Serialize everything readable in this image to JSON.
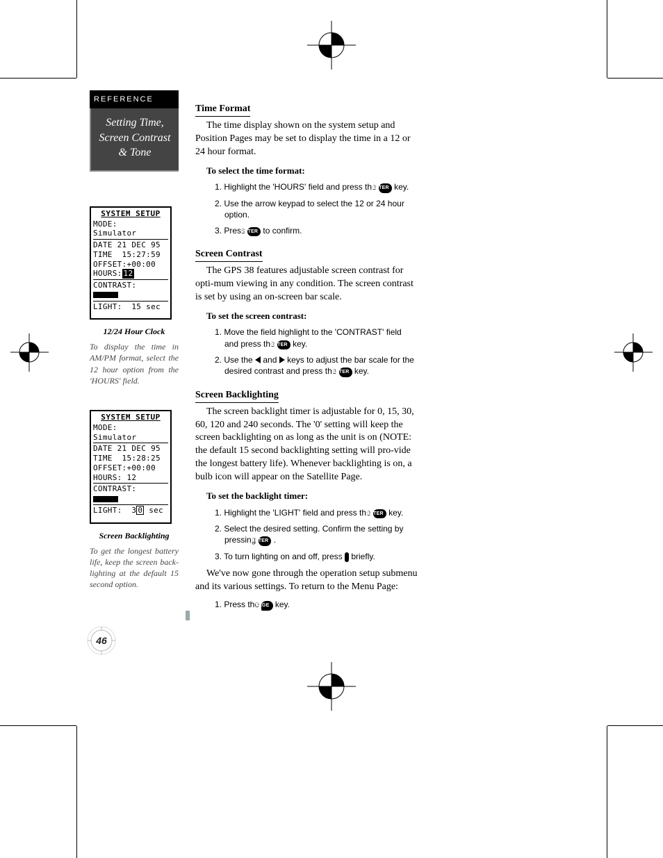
{
  "sidebar": {
    "tab": "REFERENCE",
    "title_l1": "Setting Time,",
    "title_l2": "Screen Contrast",
    "title_l3": "& Tone"
  },
  "lcd1": {
    "header": "SYSTEM SETUP",
    "mode_label": "MODE:",
    "mode_value": "Simulator",
    "date": "DATE 21 DEC 95",
    "time": "TIME  15:27:59",
    "offset": "OFFSET:+00:00",
    "hours_label": "HOURS:",
    "hours_value": "12",
    "contrast_label": "CONTRAST:",
    "light": "LIGHT:  15 sec",
    "caption": "12/24 Hour Clock",
    "note": "To display the time in AM/PM format, select the 12 hour option from the 'HOURS' field."
  },
  "lcd2": {
    "header": "SYSTEM SETUP",
    "mode_label": "MODE:",
    "mode_value": "Simulator",
    "date": "DATE 21 DEC 95",
    "time": "TIME  15:28:25",
    "offset": "OFFSET:+00:00",
    "hours": "HOURS: 12",
    "contrast_label": "CONTRAST:",
    "light_label": "LIGHT:  ",
    "light_d1": "3",
    "light_d2": "0",
    "light_unit": " sec",
    "caption": "Screen Backlighting",
    "note": "To get the longest battery life, keep the screen back-lighting at the default 15 second option."
  },
  "page_number": "46",
  "main": {
    "s1_h": "Time Format",
    "s1_p": "The time display shown on the system setup and Position Pages may be set to display the time in a 12 or 24 hour format.",
    "s1_sub": "To select the time format:",
    "s1_1a": "1. Highlight the 'HOURS' field and press the ",
    "s1_1b": " key.",
    "s1_2": "2. Use the arrow keypad to select the 12 or 24 hour option.",
    "s1_3a": "3. Press ",
    "s1_3b": " to confirm.",
    "s2_h": "Screen Contrast",
    "s2_p": "The GPS 38 features adjustable screen contrast for opti-mum viewing in any condition. The screen contrast is set by using an on-screen bar scale.",
    "s2_sub": "To set the screen contrast:",
    "s2_1a": "1. Move the field highlight to the 'CONTRAST' field and press the ",
    "s2_1b": " key.",
    "s2_2a": "2. Use the ",
    "s2_2b": " and ",
    "s2_2c": " keys to adjust the bar scale for the desired contrast and press the ",
    "s2_2d": " key.",
    "s3_h": "Screen Backlighting",
    "s3_p": "The screen backlight timer is adjustable for 0, 15, 30, 60, 120 and 240 seconds. The '0' setting will keep the screen backlighting on as long as the unit is on (NOTE: the default 15 second backlighting setting will pro-vide the longest battery life). Whenever backlighting is on, a bulb icon will appear on the Satellite Page.",
    "s3_sub": "To set the backlight timer:",
    "s3_1a": "1. Highlight the 'LIGHT' field and press the ",
    "s3_1b": " key.",
    "s3_2a": "2. Select the desired setting. Confirm the setting by pressing ",
    "s3_2b": " .",
    "s3_3a": "3. To turn lighting on and off, press ",
    "s3_3b": " briefly.",
    "s3_p2": "We've now gone through the operation setup submenu and its various settings. To return to the Menu Page:",
    "s3_4a": "1. Press the ",
    "s3_4b": " key.",
    "key_enter": "ENTER",
    "key_page": "PAGE",
    "key_light": "☼"
  }
}
